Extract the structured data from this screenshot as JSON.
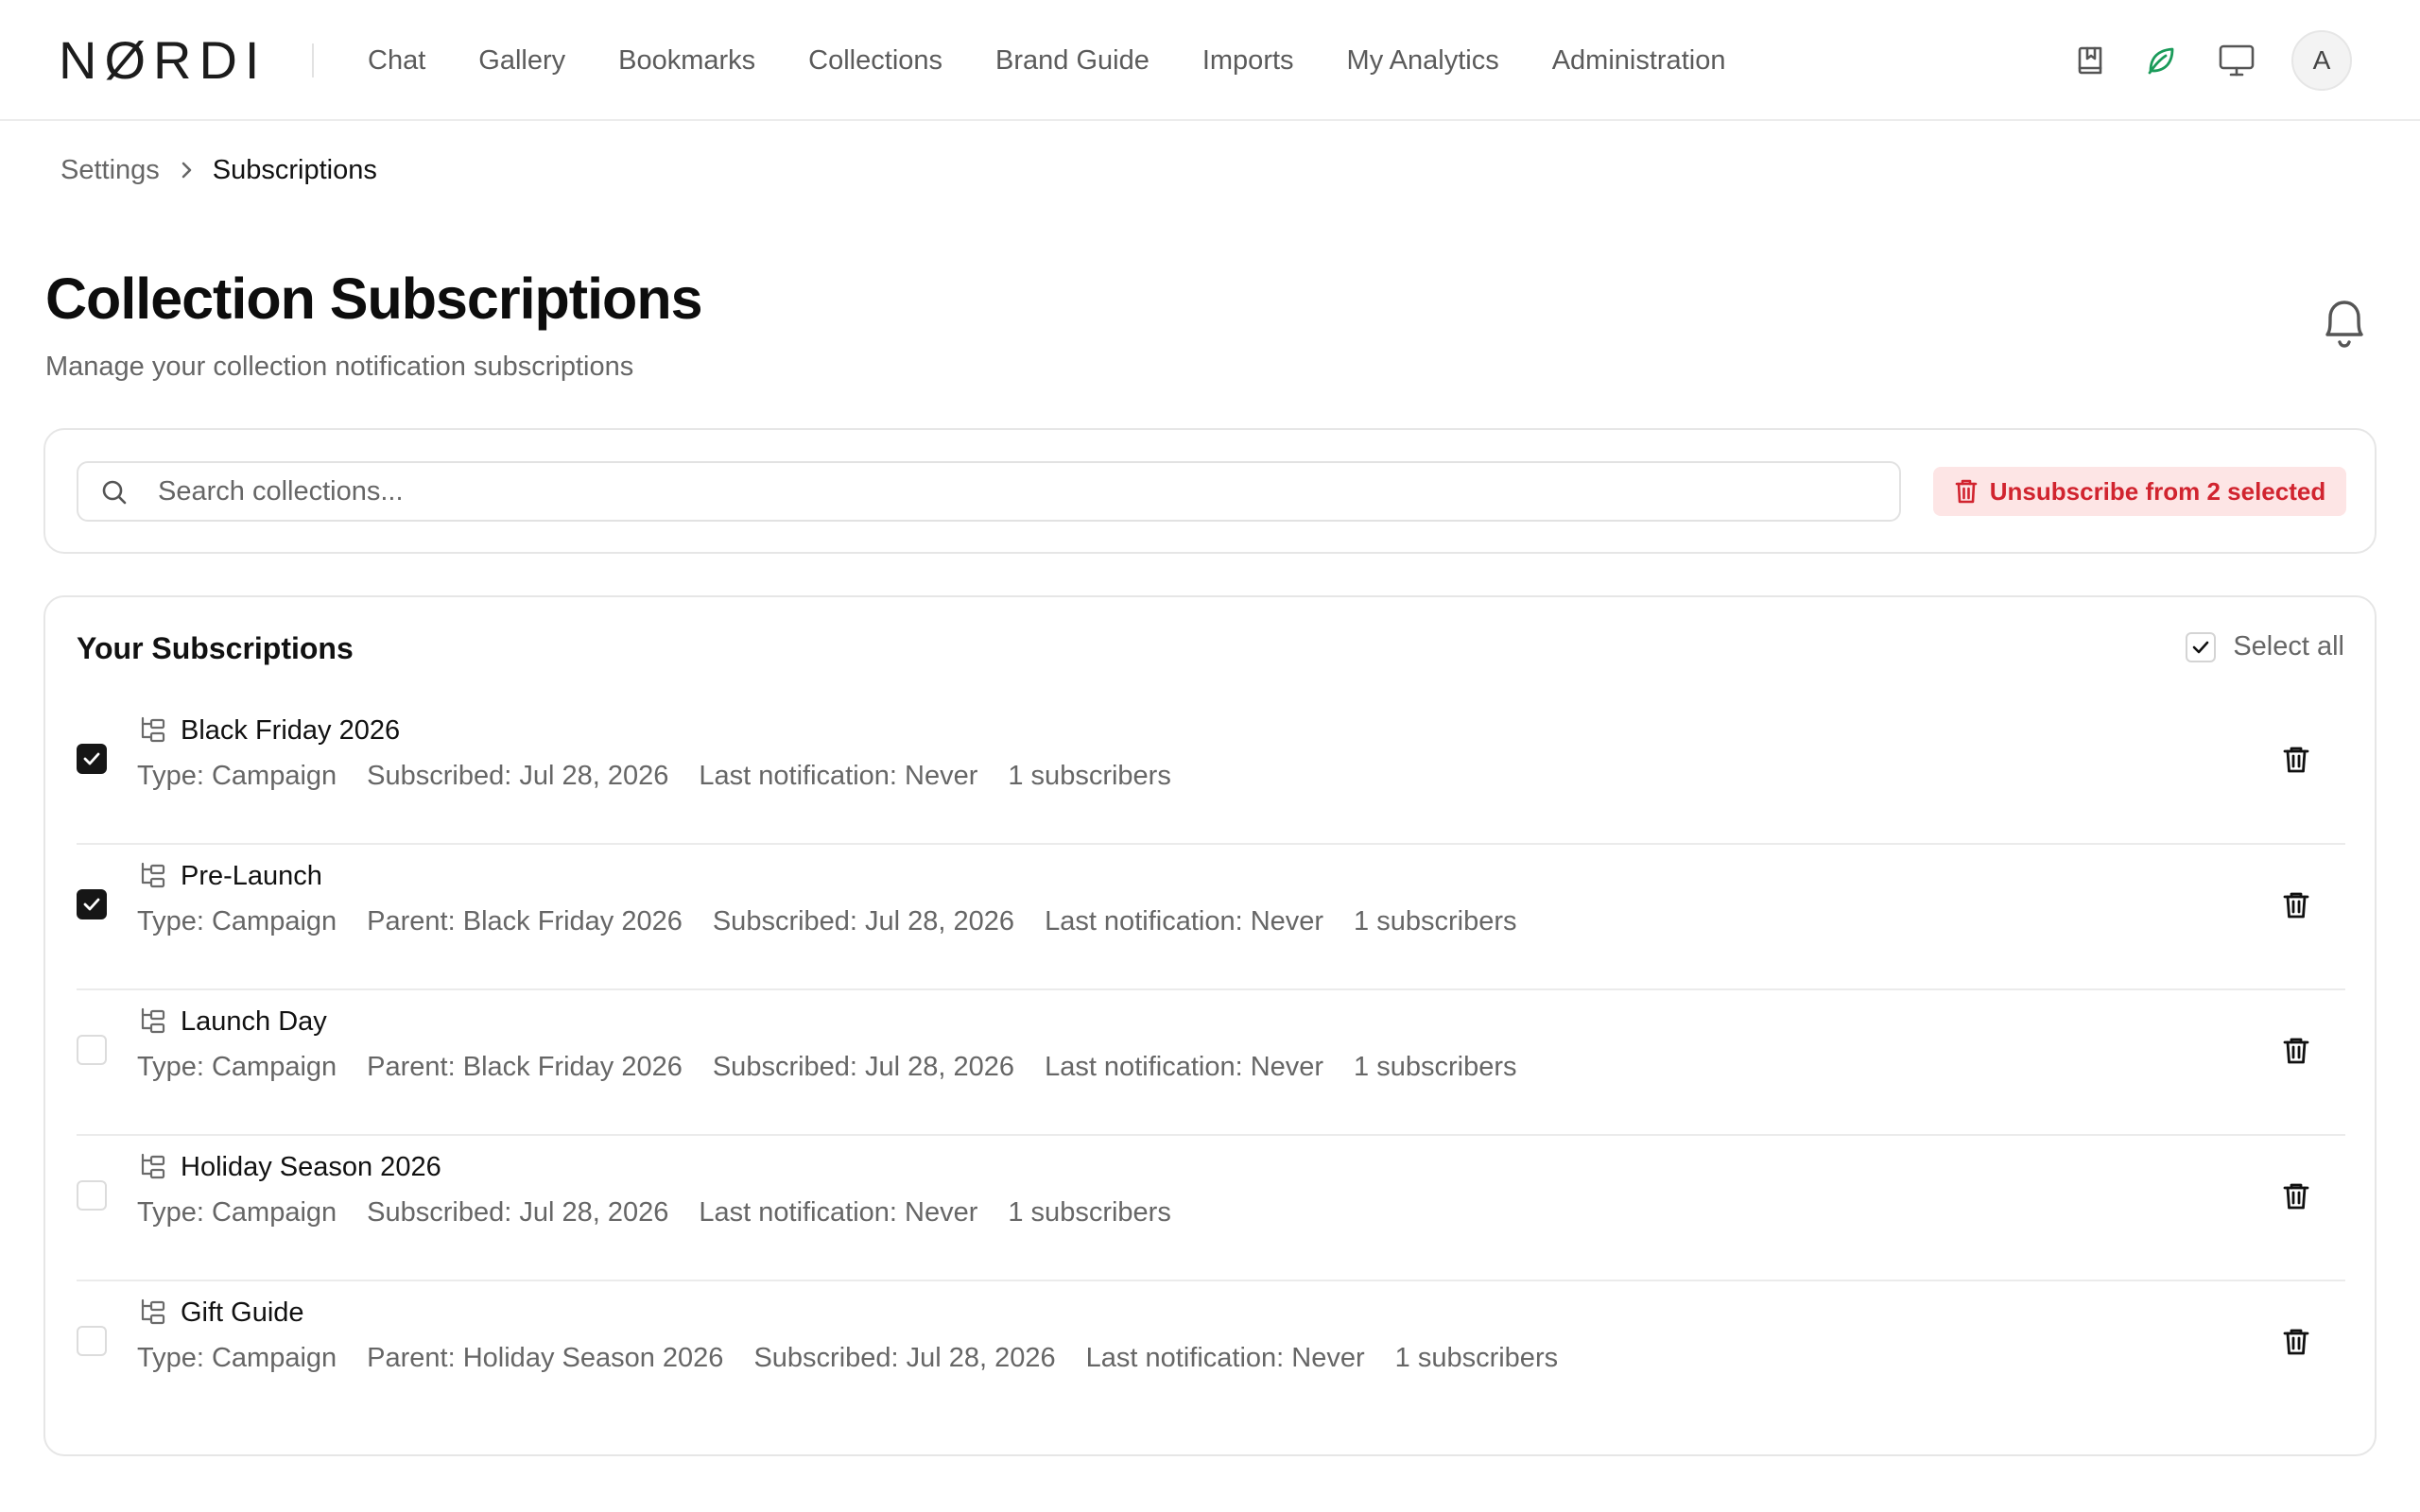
{
  "brand": {
    "logo_text": "NØRDI"
  },
  "nav": {
    "items": [
      {
        "label": "Chat"
      },
      {
        "label": "Gallery"
      },
      {
        "label": "Bookmarks"
      },
      {
        "label": "Collections"
      },
      {
        "label": "Brand Guide"
      },
      {
        "label": "Imports"
      },
      {
        "label": "My Analytics"
      },
      {
        "label": "Administration"
      }
    ],
    "icons": [
      "bookmark-book-icon",
      "leaf-icon",
      "monitor-icon"
    ],
    "avatar_initial": "A",
    "accent_leaf_color": "#1a9b5a"
  },
  "breadcrumb": {
    "parent": "Settings",
    "current": "Subscriptions"
  },
  "header": {
    "title": "Collection Subscriptions",
    "subtitle": "Manage your collection notification subscriptions"
  },
  "search": {
    "placeholder": "Search collections...",
    "value": ""
  },
  "bulk_action": {
    "label": "Unsubscribe from 2 selected",
    "color": "#d1242f",
    "bg": "#fde5e5"
  },
  "list": {
    "title": "Your Subscriptions",
    "select_all_label": "Select all",
    "select_all_checked": true,
    "rows": [
      {
        "name": "Black Friday 2026",
        "checked": true,
        "meta": [
          "Type: Campaign",
          "Subscribed: Jul 28, 2026",
          "Last notification: Never",
          "1 subscribers"
        ]
      },
      {
        "name": "Pre-Launch",
        "checked": true,
        "meta": [
          "Type: Campaign",
          "Parent: Black Friday 2026",
          "Subscribed: Jul 28, 2026",
          "Last notification: Never",
          "1 subscribers"
        ]
      },
      {
        "name": "Launch Day",
        "checked": false,
        "meta": [
          "Type: Campaign",
          "Parent: Black Friday 2026",
          "Subscribed: Jul 28, 2026",
          "Last notification: Never",
          "1 subscribers"
        ]
      },
      {
        "name": "Holiday Season 2026",
        "checked": false,
        "meta": [
          "Type: Campaign",
          "Subscribed: Jul 28, 2026",
          "Last notification: Never",
          "1 subscribers"
        ]
      },
      {
        "name": "Gift Guide",
        "checked": false,
        "meta": [
          "Type: Campaign",
          "Parent: Holiday Season 2026",
          "Subscribed: Jul 28, 2026",
          "Last notification: Never",
          "1 subscribers"
        ]
      }
    ]
  }
}
